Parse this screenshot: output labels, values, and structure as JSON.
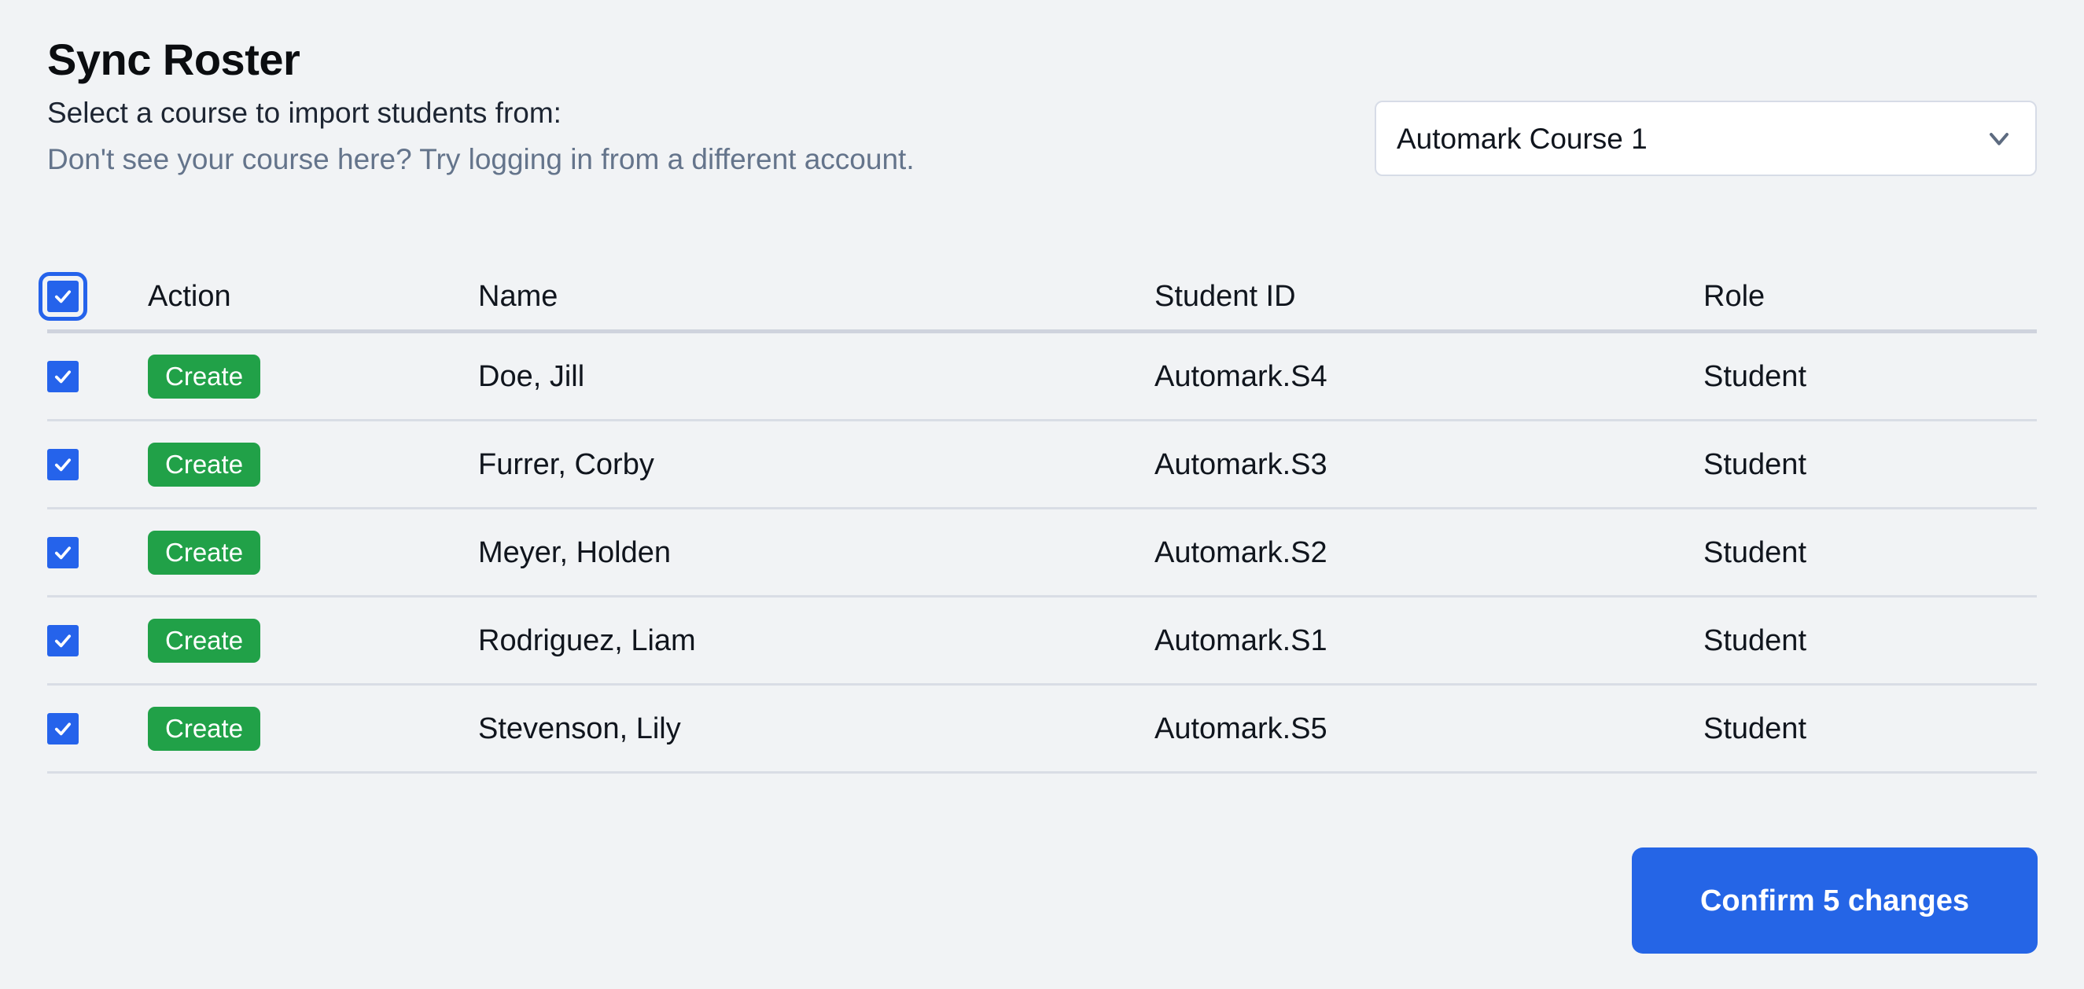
{
  "header": {
    "title": "Sync Roster",
    "subtitle": "Select a course to import students from:",
    "hint": "Don't see your course here? Try logging in from a different account."
  },
  "course_select": {
    "selected": "Automark Course 1",
    "icon": "chevron-down-icon"
  },
  "table": {
    "columns": {
      "action": "Action",
      "name": "Name",
      "student_id": "Student ID",
      "role": "Role"
    },
    "select_all_checked": true,
    "rows": [
      {
        "checked": true,
        "action": "Create",
        "name": "Doe, Jill",
        "student_id": "Automark.S4",
        "role": "Student"
      },
      {
        "checked": true,
        "action": "Create",
        "name": "Furrer, Corby",
        "student_id": "Automark.S3",
        "role": "Student"
      },
      {
        "checked": true,
        "action": "Create",
        "name": "Meyer, Holden",
        "student_id": "Automark.S2",
        "role": "Student"
      },
      {
        "checked": true,
        "action": "Create",
        "name": "Rodriguez, Liam",
        "student_id": "Automark.S1",
        "role": "Student"
      },
      {
        "checked": true,
        "action": "Create",
        "name": "Stevenson, Lily",
        "student_id": "Automark.S5",
        "role": "Student"
      }
    ]
  },
  "footer": {
    "confirm_label": "Confirm 5 changes"
  },
  "colors": {
    "page_background": "#f1f3f5",
    "accent_blue": "#2565e6",
    "checkbox_blue": "#2563eb",
    "create_green": "#21a148",
    "hint_gray": "#64748b",
    "border_gray": "#d9dde5"
  }
}
